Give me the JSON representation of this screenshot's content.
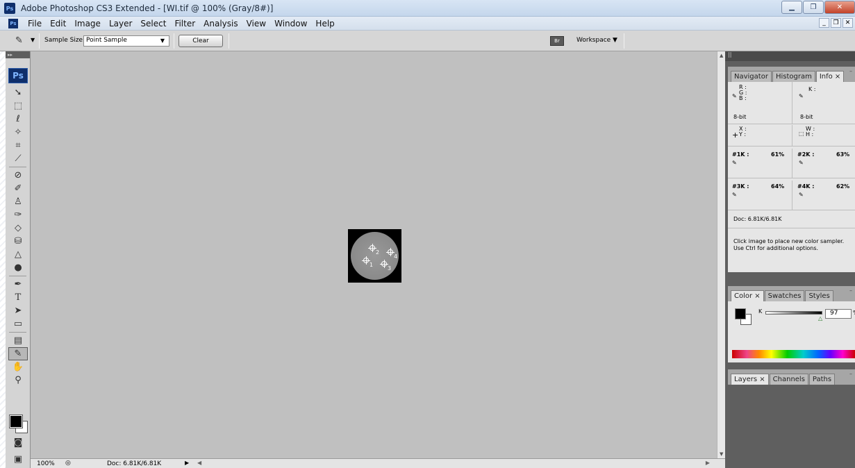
{
  "window": {
    "app_icon": "Ps",
    "title": "Adobe Photoshop CS3 Extended - [WI.tif @ 100% (Gray/8#)]",
    "buttons": [
      "minimize",
      "maximize",
      "close"
    ]
  },
  "menubar": {
    "items": [
      "File",
      "Edit",
      "Image",
      "Layer",
      "Select",
      "Filter",
      "Analysis",
      "View",
      "Window",
      "Help"
    ]
  },
  "options": {
    "sample_size_label": "Sample Size:",
    "sample_size_value": "Point Sample",
    "clear_label": "Clear",
    "workspace_label": "Workspace ▼"
  },
  "toolbox": {
    "logo": "Ps",
    "tools": [
      "move",
      "marquee",
      "lasso",
      "magic-wand",
      "crop",
      "slice",
      "healing",
      "brush",
      "clone-stamp",
      "history-brush",
      "eraser",
      "paint-bucket",
      "blur",
      "dodge",
      "pen",
      "type",
      "path-select",
      "shape",
      "notes",
      "color-sampler",
      "hand",
      "zoom"
    ]
  },
  "canvas": {
    "samplers": [
      {
        "num": "1"
      },
      {
        "num": "2"
      },
      {
        "num": "3"
      },
      {
        "num": "4"
      }
    ]
  },
  "status": {
    "zoom": "100%",
    "doc": "Doc: 6.81K/6.81K"
  },
  "info_panel": {
    "tabs": [
      "Navigator",
      "Histogram",
      "Info ×"
    ],
    "rgb_labels": "R :\nG :\nB :",
    "k_label": "K :",
    "bit_left": "8-bit",
    "bit_right": "8-bit",
    "xy_labels": "X :\nY :",
    "wh_labels": "W :\nH :",
    "s1_label": "#1K :",
    "s1_value": "61%",
    "s2_label": "#2K :",
    "s2_value": "63%",
    "s3_label": "#3K :",
    "s3_value": "64%",
    "s4_label": "#4K :",
    "s4_value": "62%",
    "doc": "Doc: 6.81K/6.81K",
    "hint_line1": "Click image to place new color sampler.",
    "hint_line2": "Use Ctrl for additional options."
  },
  "color_panel": {
    "tabs": [
      "Color ×",
      "Swatches",
      "Styles"
    ],
    "k_label": "K",
    "k_value": "97",
    "k_unit": "%"
  },
  "layers_panel": {
    "tabs": [
      "Layers ×",
      "Channels",
      "Paths"
    ]
  }
}
